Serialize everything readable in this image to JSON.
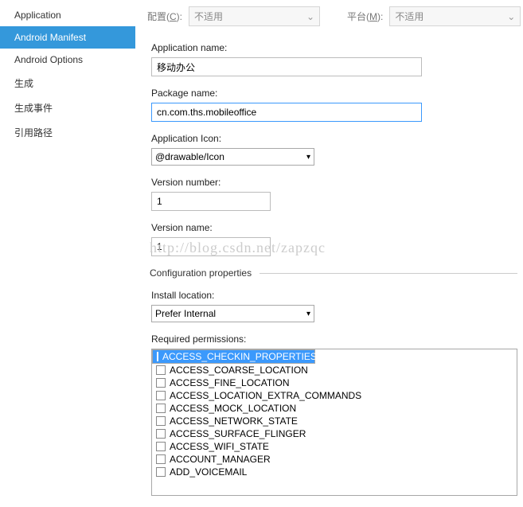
{
  "sidebar": {
    "items": [
      {
        "label": "Application"
      },
      {
        "label": "Android Manifest"
      },
      {
        "label": "Android Options"
      },
      {
        "label": "生成"
      },
      {
        "label": "生成事件"
      },
      {
        "label": "引用路径"
      }
    ],
    "activeIndex": 1
  },
  "toprow": {
    "config_label_pre": "配置(",
    "config_hotkey": "C",
    "config_label_post": "):",
    "config_value": "不适用",
    "platform_label_pre": "平台(",
    "platform_hotkey": "M",
    "platform_label_post": "):",
    "platform_value": "不适用"
  },
  "form": {
    "app_name_label": "Application name:",
    "app_name_value": "移动办公",
    "package_label": "Package name:",
    "package_value": "cn.com.ths.mobileoffice",
    "icon_label": "Application Icon:",
    "icon_value": "@drawable/Icon",
    "version_num_label": "Version number:",
    "version_num_value": "1",
    "version_name_label": "Version name:",
    "version_name_value": "1",
    "config_section": "Configuration properties",
    "install_label": "Install location:",
    "install_value": "Prefer Internal",
    "perm_label": "Required permissions:"
  },
  "permissions": [
    {
      "name": "ACCESS_CHECKIN_PROPERTIES",
      "selected": true
    },
    {
      "name": "ACCESS_COARSE_LOCATION",
      "selected": false
    },
    {
      "name": "ACCESS_FINE_LOCATION",
      "selected": false
    },
    {
      "name": "ACCESS_LOCATION_EXTRA_COMMANDS",
      "selected": false
    },
    {
      "name": "ACCESS_MOCK_LOCATION",
      "selected": false
    },
    {
      "name": "ACCESS_NETWORK_STATE",
      "selected": false
    },
    {
      "name": "ACCESS_SURFACE_FLINGER",
      "selected": false
    },
    {
      "name": "ACCESS_WIFI_STATE",
      "selected": false
    },
    {
      "name": "ACCOUNT_MANAGER",
      "selected": false
    },
    {
      "name": "ADD_VOICEMAIL",
      "selected": false
    }
  ],
  "watermark": "http://blog.csdn.net/zapzqc"
}
